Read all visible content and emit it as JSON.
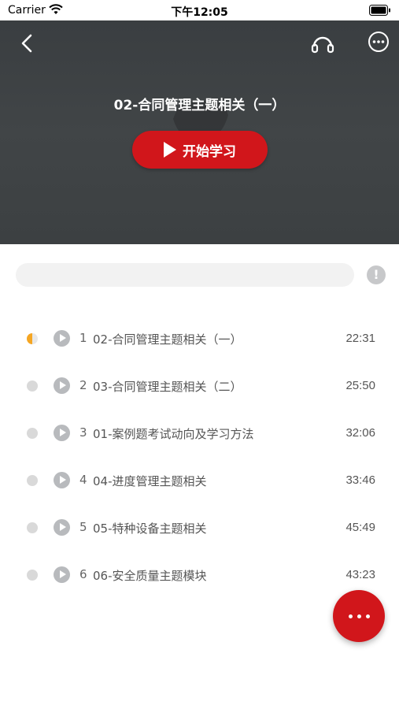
{
  "status_bar": {
    "carrier": "Carrier",
    "time": "下午12:05"
  },
  "header": {
    "title": "02-合同管理主题相关（一）",
    "start_label": "开始学习"
  },
  "search": {
    "placeholder": ""
  },
  "info_label": "!",
  "lessons": [
    {
      "index": "1",
      "title": "02-合同管理主题相关（一）",
      "duration": "22:31",
      "status": "in-progress"
    },
    {
      "index": "2",
      "title": "03-合同管理主题相关（二）",
      "duration": "25:50",
      "status": "not-started"
    },
    {
      "index": "3",
      "title": "01-案例题考试动向及学习方法",
      "duration": "32:06",
      "status": "not-started"
    },
    {
      "index": "4",
      "title": "04-进度管理主题相关",
      "duration": "33:46",
      "status": "not-started"
    },
    {
      "index": "5",
      "title": "05-特种设备主题相关",
      "duration": "45:49",
      "status": "not-started"
    },
    {
      "index": "6",
      "title": "06-安全质量主题模块",
      "duration": "43:23",
      "status": "not-started"
    }
  ],
  "colors": {
    "accent": "#d1161b",
    "progress": "#f5a623",
    "hero_bg": "#3e4244"
  },
  "icons": [
    "wifi-icon",
    "battery-icon",
    "back-icon",
    "headphone-icon",
    "more-icon",
    "play-icon",
    "info-icon"
  ]
}
